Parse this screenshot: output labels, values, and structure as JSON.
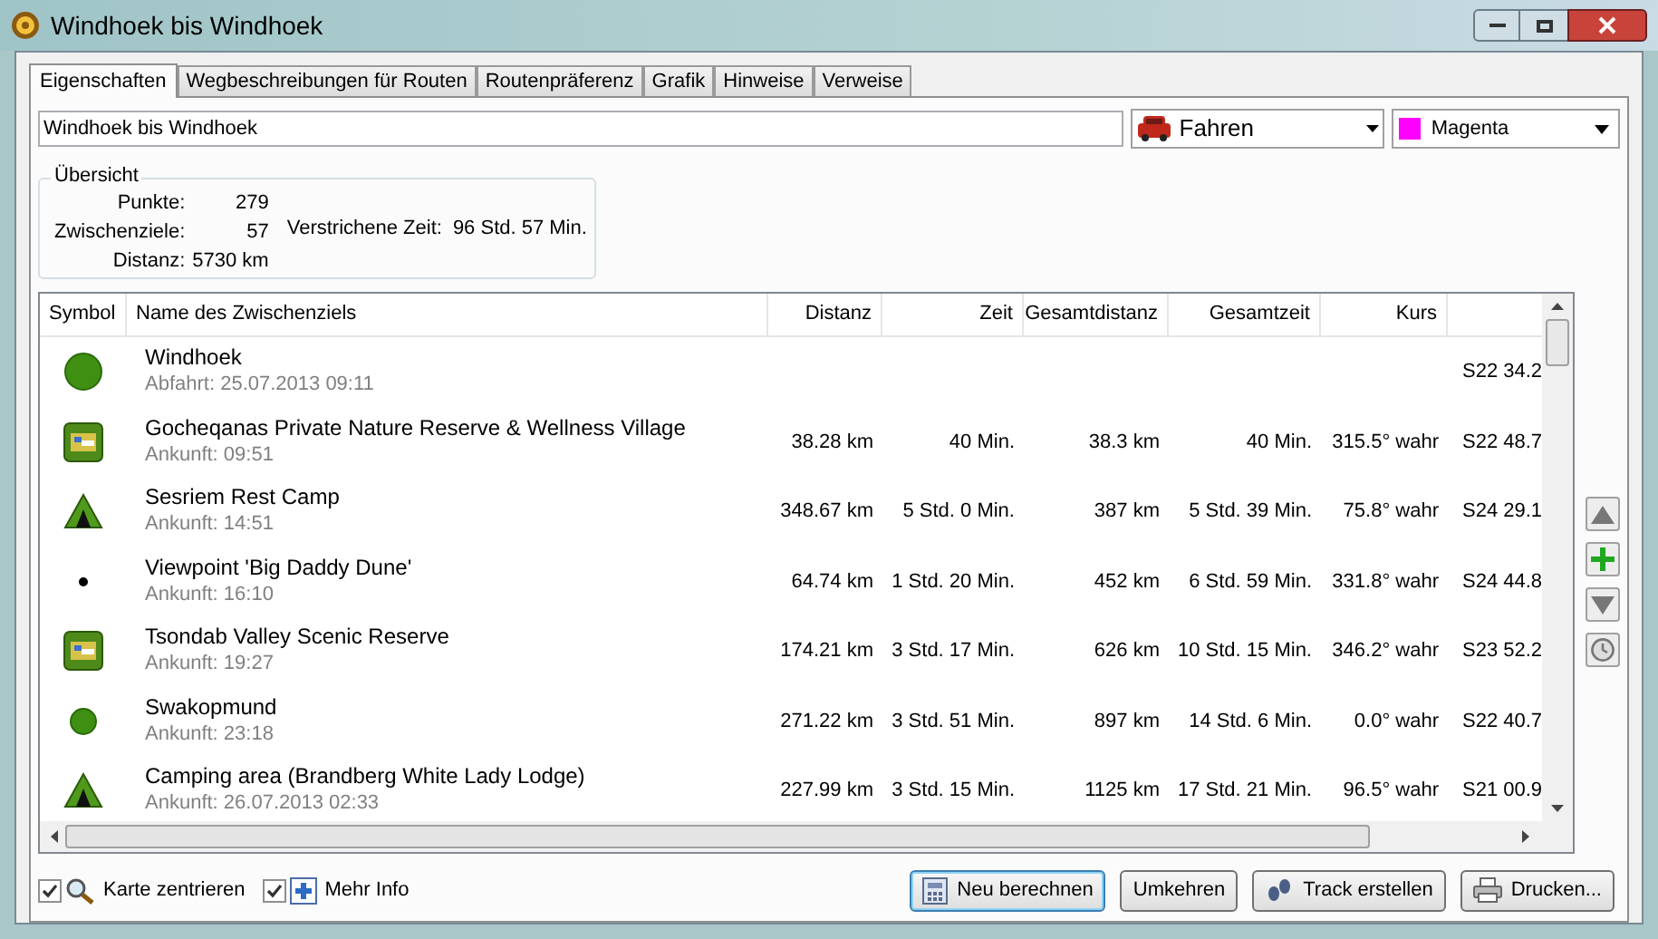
{
  "window": {
    "title": "Windhoek bis Windhoek"
  },
  "tabs": [
    {
      "label": "Eigenschaften",
      "selected": true
    },
    {
      "label": "Wegbeschreibungen für Routen",
      "selected": false
    },
    {
      "label": "Routenpräferenz",
      "selected": false
    },
    {
      "label": "Grafik",
      "selected": false
    },
    {
      "label": "Hinweise",
      "selected": false
    },
    {
      "label": "Verweise",
      "selected": false
    }
  ],
  "name_field": {
    "value": "Windhoek bis Windhoek"
  },
  "mode_select": {
    "value": "Fahren"
  },
  "color_select": {
    "value": "Magenta",
    "color": "#ff00ff"
  },
  "overview": {
    "title": "Übersicht",
    "stats": [
      {
        "label": "Punkte:",
        "value": "279"
      },
      {
        "label": "Zwischenziele:",
        "value": "57"
      },
      {
        "label": "Distanz:",
        "value": "5730 km"
      }
    ],
    "elapsed_label": "Verstrichene Zeit:",
    "elapsed_value": "96 Std. 57 Min."
  },
  "table": {
    "columns": [
      "Symbol",
      "Name des Zwischenziels",
      "Distanz",
      "Zeit",
      "Gesamtdistanz",
      "Gesamtzeit",
      "Kurs"
    ],
    "rows": [
      {
        "kind": "circle",
        "name": "Windhoek",
        "sub": "Abfahrt: 25.07.2013 09:11",
        "column_8": "S22 34.2"
      },
      {
        "kind": "bed",
        "name": "Gocheqanas Private Nature Reserve & Wellness Village",
        "sub": "Ankunft: 09:51",
        "distanz": "38.28 km",
        "zeit": "40 Min.",
        "gesamtdistanz": "38.3 km",
        "gesamtzeit": "40 Min.",
        "kurs": "315.5° wahr",
        "column_8": "S22 48.7"
      },
      {
        "kind": "tent",
        "name": "Sesriem Rest Camp",
        "sub": "Ankunft: 14:51",
        "distanz": "348.67 km",
        "zeit": "5 Std. 0 Min.",
        "gesamtdistanz": "387 km",
        "gesamtzeit": "5 Std. 39 Min.",
        "kurs": "75.8° wahr",
        "column_8": "S24 29.1"
      },
      {
        "kind": "dot",
        "name": "Viewpoint 'Big Daddy Dune'",
        "sub": "Ankunft: 16:10",
        "distanz": "64.74 km",
        "zeit": "1 Std. 20 Min.",
        "gesamtdistanz": "452 km",
        "gesamtzeit": "6 Std. 59 Min.",
        "kurs": "331.8° wahr",
        "column_8": "S24 44.8"
      },
      {
        "kind": "bed",
        "name": "Tsondab Valley Scenic Reserve",
        "sub": "Ankunft: 19:27",
        "distanz": "174.21 km",
        "zeit": "3 Std. 17 Min.",
        "gesamtdistanz": "626 km",
        "gesamtzeit": "10 Std. 15 Min.",
        "kurs": "346.2° wahr",
        "column_8": "S23 52.2"
      },
      {
        "kind": "small-circle",
        "name": "Swakopmund",
        "sub": "Ankunft: 23:18",
        "distanz": "271.22 km",
        "zeit": "3 Std. 51 Min.",
        "gesamtdistanz": "897 km",
        "gesamtzeit": "14 Std. 6 Min.",
        "kurs": "0.0° wahr",
        "column_8": "S22 40.7"
      },
      {
        "kind": "tent",
        "name": "Camping area (Brandberg White Lady Lodge)",
        "sub": "Ankunft: 26.07.2013 02:33",
        "distanz": "227.99 km",
        "zeit": "3 Std. 15 Min.",
        "gesamtdistanz": "1125 km",
        "gesamtzeit": "17 Std. 21 Min.",
        "kurs": "96.5° wahr",
        "column_8": "S21 00.9"
      }
    ]
  },
  "options": [
    {
      "label": "Karte zentrieren",
      "checked": true,
      "kind": "magnifier"
    },
    {
      "label": "Mehr Info",
      "checked": true,
      "kind": "plus"
    }
  ],
  "buttons": [
    {
      "label": "Neu berechnen",
      "kind": "calculator",
      "default": true
    },
    {
      "label": "Umkehren",
      "kind": "plain",
      "default": false
    },
    {
      "label": "Track erstellen",
      "kind": "track",
      "default": false
    },
    {
      "label": "Drucken...",
      "kind": "printer",
      "default": false
    }
  ]
}
